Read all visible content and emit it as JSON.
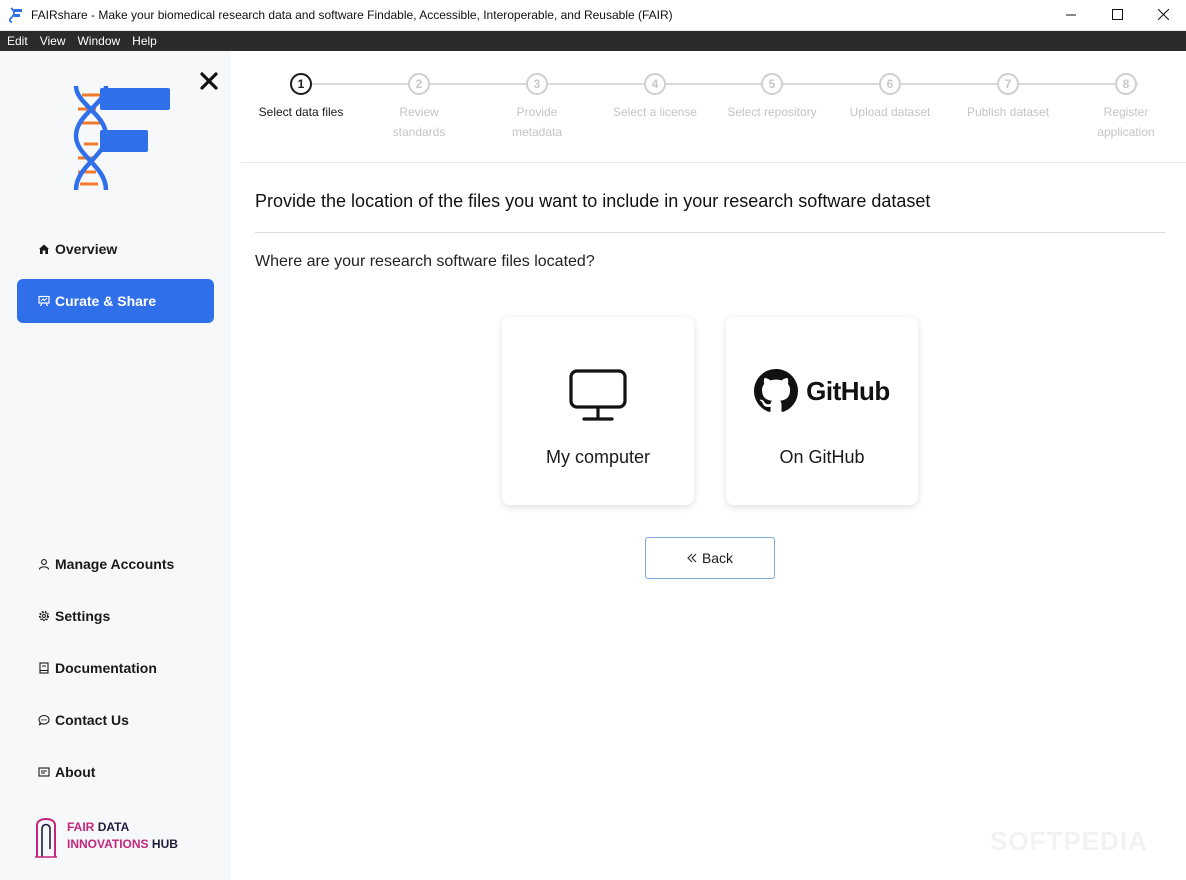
{
  "window": {
    "title": "FAIRshare - Make your biomedical research data and software Findable, Accessible, Interoperable, and Reusable (FAIR)",
    "icons": {
      "minimize": "minimize-icon",
      "maximize": "maximize-icon",
      "close": "close-icon"
    }
  },
  "menubar": {
    "items": [
      "Edit",
      "View",
      "Window",
      "Help"
    ]
  },
  "sidebar": {
    "collapse_icon": "close-icon",
    "nav": {
      "overview": {
        "label": "Overview",
        "icon": "home-icon"
      },
      "curate": {
        "label": "Curate & Share",
        "icon": "easel-icon"
      },
      "accounts": {
        "label": "Manage Accounts",
        "icon": "user-icon"
      },
      "settings": {
        "label": "Settings",
        "icon": "gear-icon"
      },
      "documentation": {
        "label": "Documentation",
        "icon": "book-icon"
      },
      "contact": {
        "label": "Contact Us",
        "icon": "chat-icon"
      },
      "about": {
        "label": "About",
        "icon": "info-card-icon"
      }
    },
    "fdih": {
      "line1a": "FAIR",
      "line1b": "DATA",
      "line2a": "INNOVATIONS",
      "line2b": "HUB"
    }
  },
  "stepper": {
    "active_index": 0,
    "steps": [
      {
        "number": "1",
        "label": "Select data files"
      },
      {
        "number": "2",
        "label": "Review standards"
      },
      {
        "number": "3",
        "label": "Provide metadata"
      },
      {
        "number": "4",
        "label": "Select a license"
      },
      {
        "number": "5",
        "label": "Select repository"
      },
      {
        "number": "6",
        "label": "Upload dataset"
      },
      {
        "number": "7",
        "label": "Publish dataset"
      },
      {
        "number": "8",
        "label": "Register application"
      }
    ]
  },
  "main": {
    "heading": "Provide the location of the files you want to include in your research software dataset",
    "question": "Where are your research software files located?",
    "options": {
      "computer": {
        "label": "My computer",
        "icon": "monitor-icon"
      },
      "github": {
        "label": "On GitHub",
        "icon": "github-logo",
        "logo_text": "GitHub"
      }
    },
    "back_label": "Back",
    "back_icon": "chevrons-left-icon"
  },
  "watermark": "SOFTPEDIA",
  "colors": {
    "accent": "#2f6fea",
    "pink": "#c3267b",
    "menubar": "#2b2b2b",
    "sidebar": "#f7f8fa"
  }
}
